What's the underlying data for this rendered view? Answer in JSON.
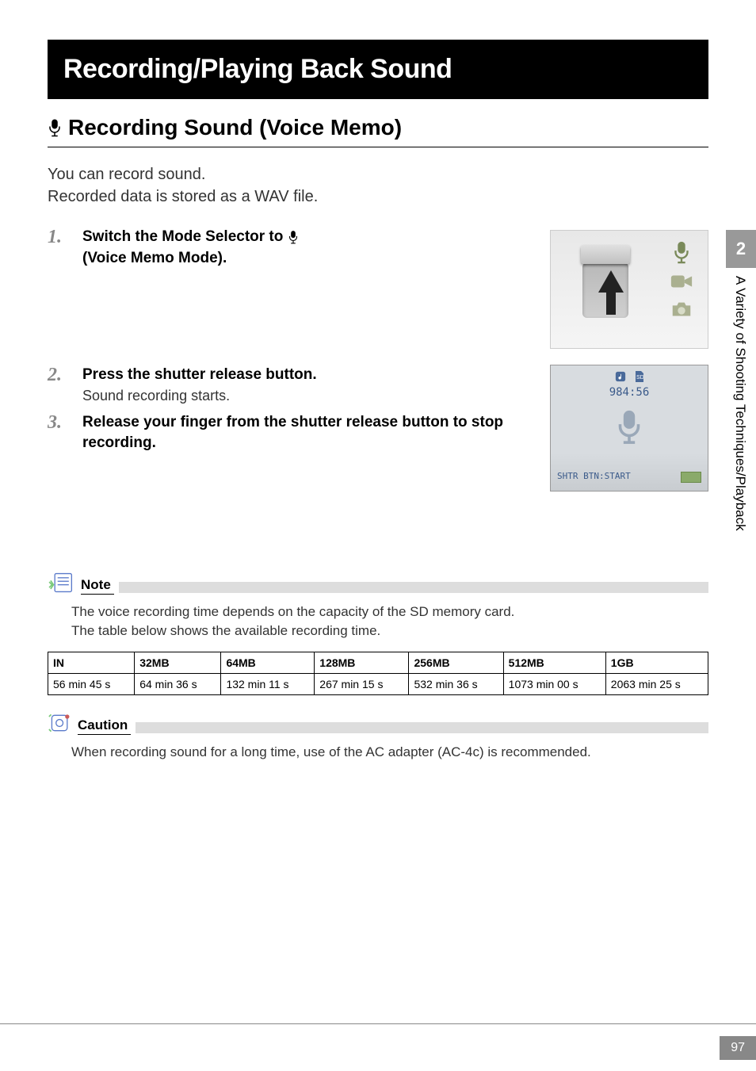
{
  "title": "Recording/Playing Back Sound",
  "subtitle": "Recording Sound (Voice Memo)",
  "intro_line1": "You can record sound.",
  "intro_line2": "Recorded data is stored as a WAV file.",
  "steps": [
    {
      "num": "1.",
      "title_a": "Switch the Mode Selector to ",
      "title_b": "(Voice Memo Mode)."
    },
    {
      "num": "2.",
      "title": "Press the shutter release button.",
      "sub": "Sound recording starts."
    },
    {
      "num": "3.",
      "title": "Release your finger from the shutter release button to stop recording."
    }
  ],
  "lcd": {
    "time": "984:56",
    "bottom": "SHTR BTN:START"
  },
  "side": {
    "num": "2",
    "text": "A Variety of Shooting Techniques/Playback"
  },
  "note": {
    "label": "Note",
    "text1": "The voice recording time depends on the capacity of the SD memory card.",
    "text2": "The table below shows the available recording time."
  },
  "table": {
    "headers": [
      "IN",
      "32MB",
      "64MB",
      "128MB",
      "256MB",
      "512MB",
      "1GB"
    ],
    "row": [
      "56 min 45 s",
      "64 min 36 s",
      "132 min 11 s",
      "267 min 15 s",
      "532 min 36 s",
      "1073 min 00 s",
      "2063 min 25 s"
    ]
  },
  "caution": {
    "label": "Caution",
    "text": "When recording sound for a long time, use of the AC adapter (AC-4c) is recommended."
  },
  "page_number": "97"
}
